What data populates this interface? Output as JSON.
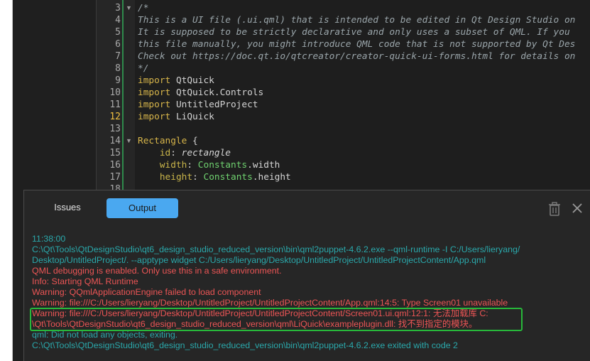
{
  "editor": {
    "lines": [
      {
        "n": "3",
        "text": "/*"
      },
      {
        "n": "4",
        "text": "This is a UI file (.ui.qml) that is intended to be edited in Qt Design Studio on"
      },
      {
        "n": "5",
        "text": "It is supposed to be strictly declarative and only uses a subset of QML. If you"
      },
      {
        "n": "6",
        "text": "this file manually, you might introduce QML code that is not supported by Qt Des"
      },
      {
        "n": "7",
        "text": "Check out https://doc.qt.io/qtcreator/creator-quick-ui-forms.html for details on"
      },
      {
        "n": "8",
        "text": "*/"
      },
      {
        "n": "9",
        "kw": "import",
        "rest": " QtQuick"
      },
      {
        "n": "10",
        "kw": "import",
        "rest": " QtQuick.Controls"
      },
      {
        "n": "11",
        "kw": "import",
        "rest": " UntitledProject"
      },
      {
        "n": "12",
        "kw": "import",
        "rest": " LiQuick"
      },
      {
        "n": "13"
      },
      {
        "n": "14",
        "type": "Rectangle",
        "brace": " {"
      },
      {
        "n": "15",
        "prop": "id",
        "sep": ": ",
        "val": "rectangle"
      },
      {
        "n": "16",
        "prop": "width",
        "sep": ": ",
        "obj": "Constants",
        "mem": ".width"
      },
      {
        "n": "17",
        "prop": "height",
        "sep": ": ",
        "obj": "Constants",
        "mem": ".height"
      },
      {
        "n": "18"
      }
    ],
    "current_line": "12"
  },
  "panel": {
    "tabs": {
      "issues": "Issues",
      "output": "Output"
    },
    "output": [
      {
        "cls": "teal",
        "text": "11:38:00"
      },
      {
        "cls": "teal",
        "text": "C:\\Qt\\Tools\\QtDesignStudio\\qt6_design_studio_reduced_version\\bin\\qml2puppet-4.6.2.exe --qml-runtime -I C:/Users/lieryang/"
      },
      {
        "cls": "teal",
        "text": "Desktop/UntitledProject/. --apptype widget C:/Users/lieryang/Desktop/UntitledProject/UntitledProjectContent/App.qml"
      },
      {
        "cls": "red",
        "text": "QML debugging is enabled. Only use this in a safe environment."
      },
      {
        "cls": "red",
        "text": "Info: Starting QML Runtime"
      },
      {
        "cls": "red",
        "text": "Warning: QQmlApplicationEngine failed to load component"
      },
      {
        "cls": "red",
        "text": "Warning: file:///C:/Users/lieryang/Desktop/UntitledProject/UntitledProjectContent/App.qml:14:5: Type Screen01 unavailable"
      },
      {
        "cls": "red",
        "text": "Warning: file:///C:/Users/lieryang/Desktop/UntitledProject/UntitledProjectContent/Screen01.ui.qml:12:1: 无法加载库 C:"
      },
      {
        "cls": "red",
        "text": "\\Qt\\Tools\\QtDesignStudio\\qt6_design_studio_reduced_version\\qml\\LiQuick\\exampleplugin.dll: 找不到指定的模块。"
      },
      {
        "cls": "teal",
        "text": "qml: Did not load any objects, exiting."
      },
      {
        "cls": "teal",
        "text": "C:\\Qt\\Tools\\QtDesignStudio\\qt6_design_studio_reduced_version\\bin\\qml2puppet-4.6.2.exe exited with code 2"
      }
    ]
  },
  "icons": {
    "clear": "trash-icon",
    "close": "close-icon"
  },
  "colors": {
    "accent_tab": "#4aa8f0",
    "highlight": "#27b83a",
    "error": "#ec5555",
    "info": "#2aa8ab"
  }
}
